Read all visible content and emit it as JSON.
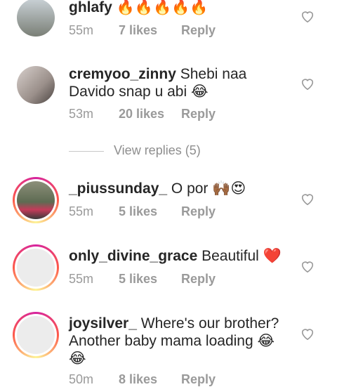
{
  "comments": [
    {
      "username": "ghlafy",
      "text": "",
      "emoji": "🔥🔥🔥🔥🔥",
      "time": "55m",
      "likes": "7 likes",
      "reply": "Reply"
    },
    {
      "username": "cremyoo_zinny",
      "text": "Shebi naa Davido snap u abi",
      "emoji": "😂",
      "time": "53m",
      "likes": "20 likes",
      "reply": "Reply"
    },
    {
      "username": "_piussunday_",
      "text": "O por",
      "emoji": "🙌🏾😍",
      "time": "55m",
      "likes": "5 likes",
      "reply": "Reply"
    },
    {
      "username": "only_divine_grace",
      "text": "Beautiful",
      "emoji": "❤️",
      "time": "55m",
      "likes": "5 likes",
      "reply": "Reply"
    },
    {
      "username": "joysilver_",
      "text": "Where's our brother? Another baby mama loading",
      "emoji": "😂 😂",
      "time": "50m",
      "likes": "8 likes",
      "reply": "Reply"
    }
  ],
  "view_replies": "View replies (5)",
  "colors": {
    "meta": "#9a9a9a",
    "heart_outline": "#9a9a9a",
    "emoji_heart": "#e0245e"
  },
  "icons": {
    "like": "heart-outline-icon"
  }
}
